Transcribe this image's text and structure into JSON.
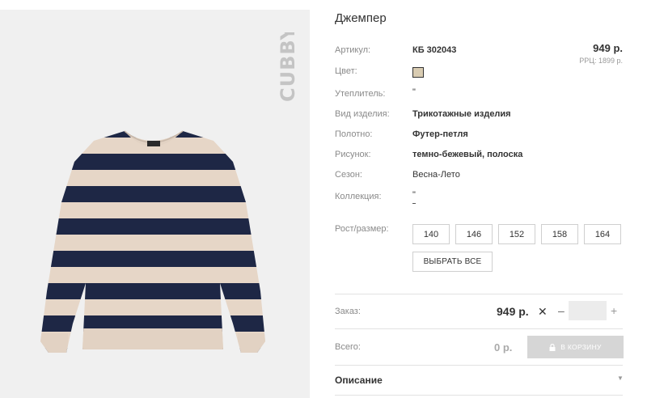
{
  "brand": {
    "logo_text": "CUBBY"
  },
  "product": {
    "title": "Джемпер",
    "price": "949 р.",
    "rrp": "РРЦ: 1899 р.",
    "color_swatch": "#d9ccb2",
    "sweater_colors": {
      "navy": "#1e2745",
      "beige": "#e6d6c7",
      "background": "#f0f0f0"
    },
    "attributes": [
      {
        "label": "Артикул:",
        "value": "КБ 302043",
        "bold": true
      },
      {
        "label": "Цвет:",
        "value": "",
        "bold": false
      },
      {
        "label": "Утеплитель:",
        "value": "\"",
        "bold": false
      },
      {
        "label": "Вид изделия:",
        "value": "Трикотажные изделия",
        "bold": true
      },
      {
        "label": "Полотно:",
        "value": "Футер-петля",
        "bold": true
      },
      {
        "label": "Рисунок:",
        "value": "темно-бежевый, полоска",
        "bold": true
      },
      {
        "label": "Сезон:",
        "value": "Весна-Лето",
        "bold": false
      },
      {
        "label": "Коллекция:",
        "value": "\"",
        "bold": false
      }
    ]
  },
  "sizes": {
    "label": "Рост/размер:",
    "options": [
      "140",
      "146",
      "152",
      "158",
      "164"
    ],
    "select_all": "ВЫБРАТЬ ВСЕ"
  },
  "order": {
    "label": "Заказ:",
    "price": "949 р.",
    "times": "✕",
    "minus": "–",
    "plus": "+",
    "quantity": ""
  },
  "total": {
    "label": "Всего:",
    "value": "0 р.",
    "cart_button": "В КОРЗИНУ",
    "cart_icon": "lock-icon"
  },
  "description": {
    "label": "Описание",
    "chevron": "▼"
  }
}
